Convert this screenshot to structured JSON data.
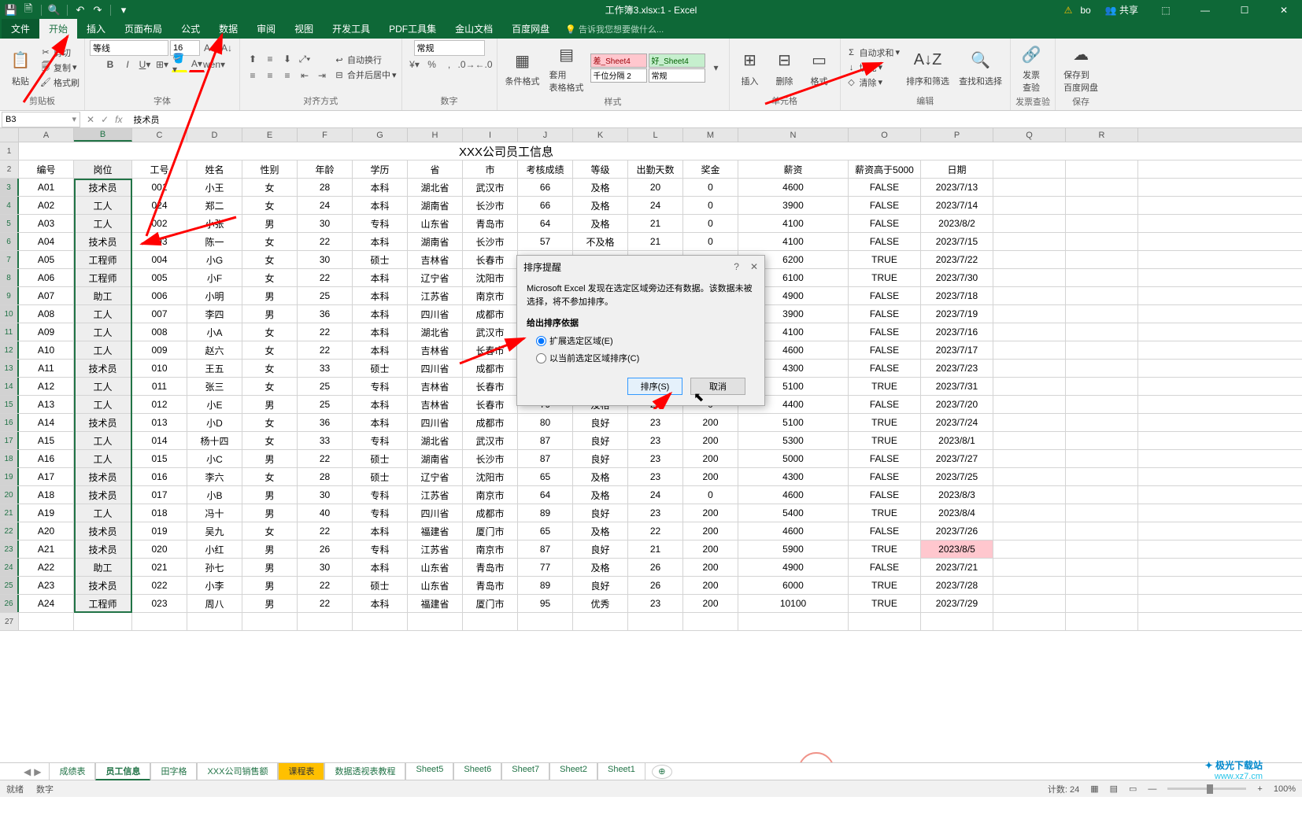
{
  "title": "工作簿3.xlsx:1 - Excel",
  "user": "bo",
  "share": "共享",
  "tabs": {
    "file": "文件",
    "home": "开始",
    "insert": "插入",
    "layout": "页面布局",
    "formulas": "公式",
    "data": "数据",
    "review": "审阅",
    "view": "视图",
    "dev": "开发工具",
    "pdf": "PDF工具集",
    "wps": "金山文档",
    "baidu": "百度网盘",
    "tell": "告诉我您想要做什么..."
  },
  "ribbon": {
    "clipboard": {
      "paste": "粘贴",
      "cut": "剪切",
      "copy": "复制",
      "painter": "格式刷",
      "label": "剪贴板"
    },
    "font": {
      "name": "等线",
      "size": "16",
      "label": "字体"
    },
    "align": {
      "wrap": "自动换行",
      "merge": "合并后居中",
      "label": "对齐方式"
    },
    "number": {
      "general": "常规",
      "label": "数字"
    },
    "styles": {
      "cond": "条件格式",
      "table": "套用\n表格格式",
      "bad": "差_Sheet4",
      "good": "好_Sheet4",
      "thousand": "千位分隔 2",
      "normal": "常规",
      "label": "样式"
    },
    "cells": {
      "insert": "插入",
      "delete": "删除",
      "format": "格式",
      "label": "单元格"
    },
    "editing": {
      "autosum": "自动求和",
      "fill": "填充",
      "clear": "清除",
      "sort": "排序和筛选",
      "find": "查找和选择",
      "label": "编辑"
    },
    "invoice": {
      "check": "发票\n查验",
      "label": "发票查验"
    },
    "save": {
      "baidu": "保存到\n百度网盘",
      "label": "保存"
    }
  },
  "namebox": "B3",
  "formula_fx": "fx",
  "formula": "技术员",
  "cols": [
    "A",
    "B",
    "C",
    "D",
    "E",
    "F",
    "G",
    "H",
    "I",
    "J",
    "K",
    "L",
    "M",
    "N",
    "O",
    "P",
    "Q",
    "R"
  ],
  "table": {
    "title": "XXX公司员工信息",
    "headers": [
      "编号",
      "岗位",
      "工号",
      "姓名",
      "性别",
      "年龄",
      "学历",
      "省",
      "市",
      "考核成绩",
      "等级",
      "出勤天数",
      "奖金",
      "薪资",
      "薪资高于5000",
      "日期"
    ],
    "rows": [
      [
        "A01",
        "技术员",
        "001",
        "小王",
        "女",
        "28",
        "本科",
        "湖北省",
        "武汉市",
        "66",
        "及格",
        "20",
        "0",
        "4600",
        "FALSE",
        "2023/7/13"
      ],
      [
        "A02",
        "工人",
        "024",
        "郑二",
        "女",
        "24",
        "本科",
        "湖南省",
        "长沙市",
        "66",
        "及格",
        "24",
        "0",
        "3900",
        "FALSE",
        "2023/7/14"
      ],
      [
        "A03",
        "工人",
        "002",
        "小张",
        "男",
        "30",
        "专科",
        "山东省",
        "青岛市",
        "64",
        "及格",
        "21",
        "0",
        "4100",
        "FALSE",
        "2023/8/2"
      ],
      [
        "A04",
        "技术员",
        "003",
        "陈一",
        "女",
        "22",
        "本科",
        "湖南省",
        "长沙市",
        "57",
        "不及格",
        "21",
        "0",
        "4100",
        "FALSE",
        "2023/7/15"
      ],
      [
        "A05",
        "工程师",
        "004",
        "小G",
        "女",
        "30",
        "硕士",
        "吉林省",
        "长春市",
        "",
        "",
        "",
        "",
        "6200",
        "TRUE",
        "2023/7/22"
      ],
      [
        "A06",
        "工程师",
        "005",
        "小F",
        "女",
        "22",
        "本科",
        "辽宁省",
        "沈阳市",
        "",
        "",
        "",
        "",
        "6100",
        "TRUE",
        "2023/7/30"
      ],
      [
        "A07",
        "助工",
        "006",
        "小明",
        "男",
        "25",
        "本科",
        "江苏省",
        "南京市",
        "",
        "",
        "",
        "",
        "4900",
        "FALSE",
        "2023/7/18"
      ],
      [
        "A08",
        "工人",
        "007",
        "李四",
        "男",
        "36",
        "本科",
        "四川省",
        "成都市",
        "",
        "",
        "",
        "",
        "3900",
        "FALSE",
        "2023/7/19"
      ],
      [
        "A09",
        "工人",
        "008",
        "小A",
        "女",
        "22",
        "本科",
        "湖北省",
        "武汉市",
        "",
        "",
        "",
        "",
        "4100",
        "FALSE",
        "2023/7/16"
      ],
      [
        "A10",
        "工人",
        "009",
        "赵六",
        "女",
        "22",
        "本科",
        "吉林省",
        "长春市",
        "",
        "",
        "",
        "",
        "4600",
        "FALSE",
        "2023/7/17"
      ],
      [
        "A11",
        "技术员",
        "010",
        "王五",
        "女",
        "33",
        "硕士",
        "四川省",
        "成都市",
        "",
        "",
        "",
        "",
        "4300",
        "FALSE",
        "2023/7/23"
      ],
      [
        "A12",
        "工人",
        "011",
        "张三",
        "女",
        "25",
        "专科",
        "吉林省",
        "长春市",
        "",
        "",
        "",
        "",
        "5100",
        "TRUE",
        "2023/7/31"
      ],
      [
        "A13",
        "工人",
        "012",
        "小E",
        "男",
        "25",
        "本科",
        "吉林省",
        "长春市",
        "79",
        "及格",
        "22",
        "0",
        "4400",
        "FALSE",
        "2023/7/20"
      ],
      [
        "A14",
        "技术员",
        "013",
        "小D",
        "女",
        "36",
        "本科",
        "四川省",
        "成都市",
        "80",
        "良好",
        "23",
        "200",
        "5100",
        "TRUE",
        "2023/7/24"
      ],
      [
        "A15",
        "工人",
        "014",
        "杨十四",
        "女",
        "33",
        "专科",
        "湖北省",
        "武汉市",
        "87",
        "良好",
        "23",
        "200",
        "5300",
        "TRUE",
        "2023/8/1"
      ],
      [
        "A16",
        "工人",
        "015",
        "小C",
        "男",
        "22",
        "硕士",
        "湖南省",
        "长沙市",
        "87",
        "良好",
        "23",
        "200",
        "5000",
        "FALSE",
        "2023/7/27"
      ],
      [
        "A17",
        "技术员",
        "016",
        "李六",
        "女",
        "28",
        "硕士",
        "辽宁省",
        "沈阳市",
        "65",
        "及格",
        "23",
        "200",
        "4300",
        "FALSE",
        "2023/7/25"
      ],
      [
        "A18",
        "技术员",
        "017",
        "小B",
        "男",
        "30",
        "专科",
        "江苏省",
        "南京市",
        "64",
        "及格",
        "24",
        "0",
        "4600",
        "FALSE",
        "2023/8/3"
      ],
      [
        "A19",
        "工人",
        "018",
        "冯十",
        "男",
        "40",
        "专科",
        "四川省",
        "成都市",
        "89",
        "良好",
        "23",
        "200",
        "5400",
        "TRUE",
        "2023/8/4"
      ],
      [
        "A20",
        "技术员",
        "019",
        "吴九",
        "女",
        "22",
        "本科",
        "福建省",
        "厦门市",
        "65",
        "及格",
        "22",
        "200",
        "4600",
        "FALSE",
        "2023/7/26"
      ],
      [
        "A21",
        "技术员",
        "020",
        "小红",
        "男",
        "26",
        "专科",
        "江苏省",
        "南京市",
        "87",
        "良好",
        "21",
        "200",
        "5900",
        "TRUE",
        "2023/8/5"
      ],
      [
        "A22",
        "助工",
        "021",
        "孙七",
        "男",
        "30",
        "本科",
        "山东省",
        "青岛市",
        "77",
        "及格",
        "26",
        "200",
        "4900",
        "FALSE",
        "2023/7/21"
      ],
      [
        "A23",
        "技术员",
        "022",
        "小李",
        "男",
        "22",
        "硕士",
        "山东省",
        "青岛市",
        "89",
        "良好",
        "26",
        "200",
        "6000",
        "TRUE",
        "2023/7/28"
      ],
      [
        "A24",
        "工程师",
        "023",
        "周八",
        "男",
        "22",
        "本科",
        "福建省",
        "厦门市",
        "95",
        "优秀",
        "23",
        "200",
        "10100",
        "TRUE",
        "2023/7/29"
      ]
    ]
  },
  "dialog": {
    "title": "排序提醒",
    "msg": "Microsoft Excel 发现在选定区域旁边还有数据。该数据未被选择，将不参加排序。",
    "q": "给出排序依据",
    "opt1": "扩展选定区域(E)",
    "opt2": "以当前选定区域排序(C)",
    "ok": "排序(S)",
    "cancel": "取消"
  },
  "sheets": {
    "list": [
      "成绩表",
      "员工信息",
      "田字格",
      "XXX公司销售额",
      "课程表",
      "数据透视表教程",
      "Sheet5",
      "Sheet6",
      "Sheet7",
      "Sheet2",
      "Sheet1"
    ],
    "active": "员工信息",
    "orange": "课程表"
  },
  "status": {
    "ready": "就绪",
    "digit": "数字",
    "count_label": "计数:",
    "count": "24",
    "zoom": "100%"
  },
  "watermark": {
    "brand": "极光下载站",
    "url": "www.xz7.cm"
  }
}
